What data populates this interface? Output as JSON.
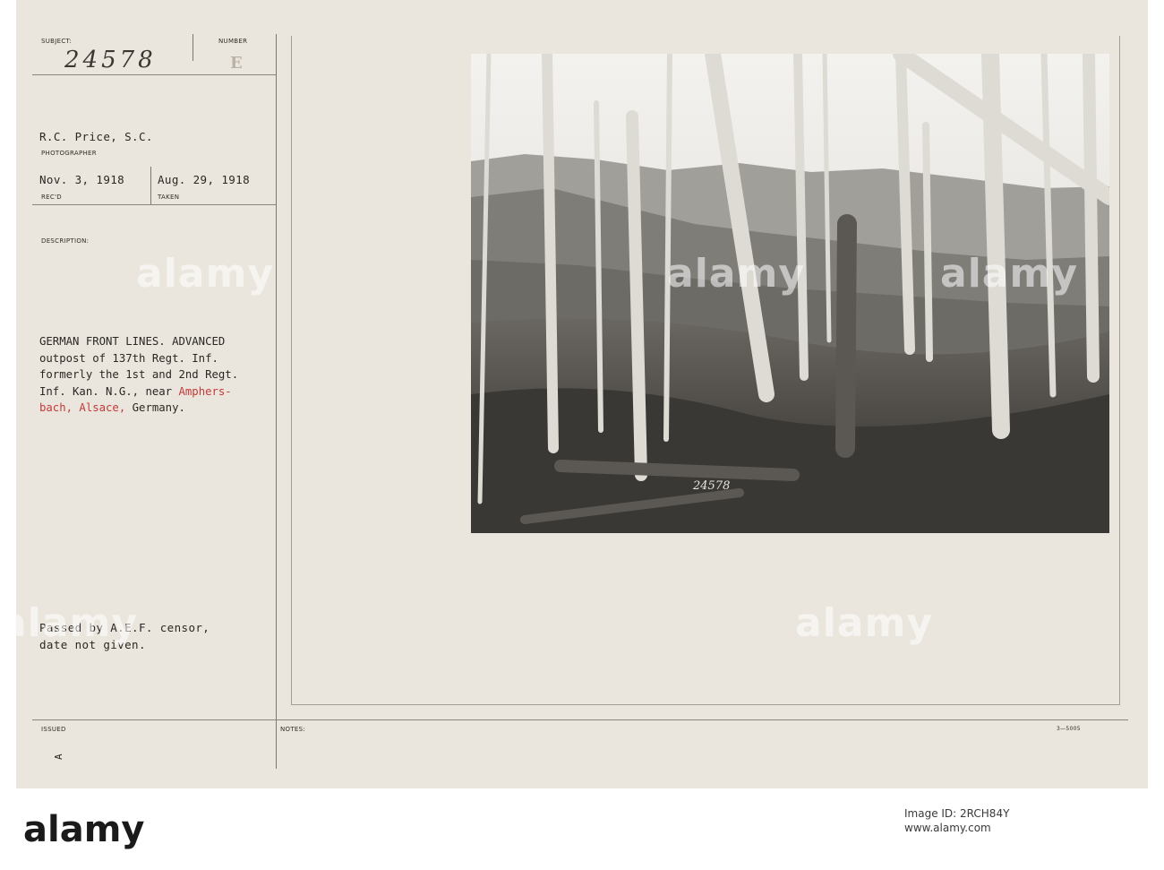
{
  "card": {
    "subject_label": "SUBJECT:",
    "subject_value": "24578",
    "number_label": "NUMBER",
    "number_value": "E",
    "photographer_name": "R.C. Price, S.C.",
    "photographer_label": "PHOTOGRAPHER",
    "received_date": "Nov. 3, 1918",
    "received_label": "REC'D",
    "taken_date": "Aug. 29, 1918",
    "taken_label": "TAKEN",
    "description_label": "DESCRIPTION:",
    "description_lines": {
      "line1": "GERMAN FRONT LINES. ADVANCED",
      "line2": "outpost of 137th Regt. Inf.",
      "line3": "formerly the 1st and 2nd Regt.",
      "line4_a": "Inf. Kan. N.G., near ",
      "line4_b": "Amphers-",
      "line5_a": "bach, Alsace,",
      "line5_b": " Germany."
    },
    "censor_line1": "Passed by A.E.F. censor,",
    "censor_line2": "date not given.",
    "issued_label": "ISSUED",
    "issued_mark": "A",
    "notes_label": "NOTES:",
    "form_number": "3—5005",
    "photo_number": "24578"
  },
  "watermarks": {
    "text": "alamy"
  },
  "footer": {
    "logo_text": "alamy",
    "image_id": "Image ID: 2RCH84Y",
    "site": "www.alamy.com"
  }
}
